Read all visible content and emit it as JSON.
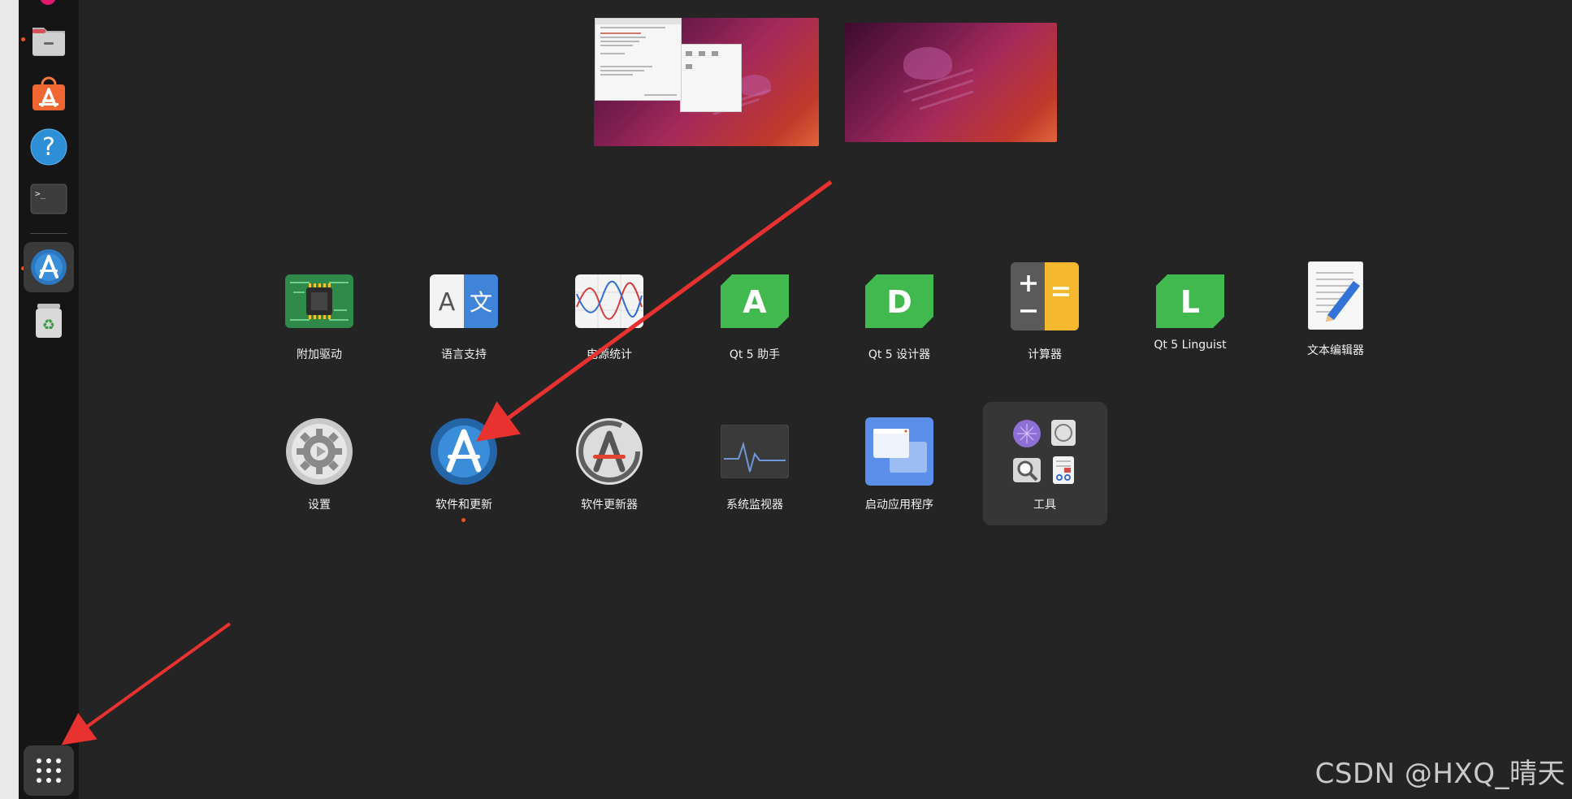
{
  "dock": {
    "items": [
      {
        "name": "files",
        "icon": "folder-icon"
      },
      {
        "name": "app-center",
        "icon": "shopping-bag-icon"
      },
      {
        "name": "help",
        "icon": "help-icon"
      },
      {
        "name": "terminal",
        "icon": "terminal-icon",
        "prompt": ">_"
      },
      {
        "name": "software-updates",
        "icon": "software-properties-icon"
      },
      {
        "name": "trash",
        "icon": "trash-icon"
      }
    ],
    "show_apps": {
      "icon": "app-grid-icon"
    }
  },
  "apps": [
    {
      "id": "additional-drivers",
      "label": "附加驱动",
      "icon": "chip-icon"
    },
    {
      "id": "language-support",
      "label": "语言支持",
      "icon": "language-icon",
      "glyph_a": "A",
      "glyph_b": "文"
    },
    {
      "id": "power-statistics",
      "label": "电源统计",
      "icon": "chart-wave-icon"
    },
    {
      "id": "qt5-assistant",
      "label": "Qt 5 助手",
      "icon": "qt-a-icon",
      "glyph": "A"
    },
    {
      "id": "qt5-designer",
      "label": "Qt 5 设计器",
      "icon": "qt-d-icon",
      "glyph": "D"
    },
    {
      "id": "calculator",
      "label": "计算器",
      "icon": "calculator-icon"
    },
    {
      "id": "qt5-linguist",
      "label": "Qt 5 Linguist",
      "icon": "qt-l-icon",
      "glyph": "L"
    },
    {
      "id": "text-editor",
      "label": "文本编辑器",
      "icon": "text-editor-icon"
    },
    {
      "id": "settings",
      "label": "设置",
      "icon": "gear-icon"
    },
    {
      "id": "software-and-updates",
      "label": "软件和更新",
      "icon": "software-properties-icon",
      "glyph": "A",
      "running": true
    },
    {
      "id": "software-updater",
      "label": "软件更新器",
      "icon": "software-updater-icon",
      "glyph": "A"
    },
    {
      "id": "system-monitor",
      "label": "系统监视器",
      "icon": "system-monitor-icon"
    },
    {
      "id": "startup-applications",
      "label": "启动应用程序",
      "icon": "startup-apps-icon"
    },
    {
      "id": "tools-folder",
      "label": "工具",
      "icon": "folder-grid-icon"
    }
  ],
  "colors": {
    "accent": "#e95420",
    "annotation_arrow": "#e8322f",
    "background": "#242424",
    "dock": "#151515"
  },
  "watermark": "CSDN @HXQ_晴天"
}
